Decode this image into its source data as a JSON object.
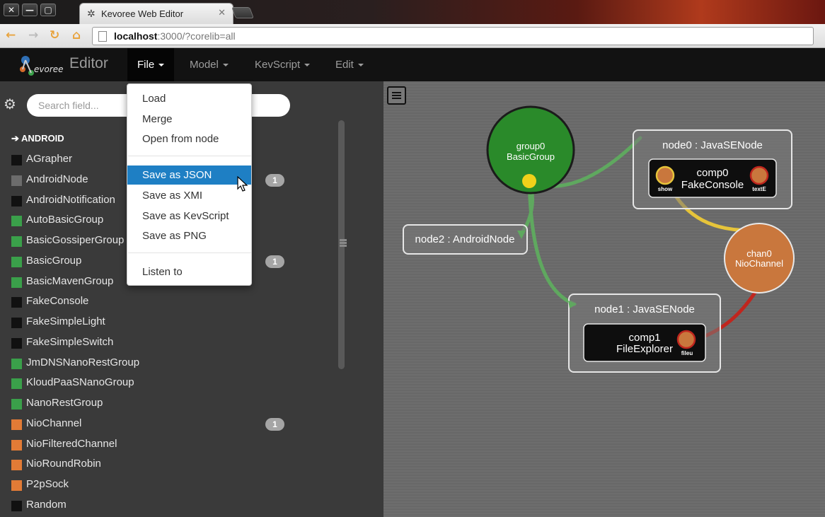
{
  "browser": {
    "window_buttons": [
      "✕",
      "—",
      "▢"
    ],
    "tab_title": "Kevoree Web Editor",
    "tab_close": "✕",
    "nav": {
      "back": "←",
      "forward": "→",
      "reload": "↻",
      "home": "⌂"
    },
    "url_host": "localhost",
    "url_rest": ":3000/?corelib=all"
  },
  "navbar": {
    "brand": "Editor",
    "menus": [
      {
        "label": "File",
        "active": true
      },
      {
        "label": "Model",
        "active": false
      },
      {
        "label": "KevScript",
        "active": false
      },
      {
        "label": "Edit",
        "active": false
      }
    ]
  },
  "file_menu": {
    "items": [
      "Load",
      "Merge",
      "Open from node",
      "Save as JSON",
      "Save as XMI",
      "Save as KevScript",
      "Save as PNG",
      "Listen to"
    ],
    "hovered": "Save as JSON"
  },
  "sidebar": {
    "search_placeholder": "Search field...",
    "section": "➔ ANDROID",
    "items": [
      {
        "label": "AGrapher",
        "color": "#111111"
      },
      {
        "label": "AndroidNode",
        "color": "#6c6c6c",
        "badge": "1"
      },
      {
        "label": "AndroidNotification",
        "color": "#111111"
      },
      {
        "label": "AutoBasicGroup",
        "color": "#3aa04a"
      },
      {
        "label": "BasicGossiperGroup",
        "color": "#3aa04a"
      },
      {
        "label": "BasicGroup",
        "color": "#3aa04a",
        "badge": "1"
      },
      {
        "label": "BasicMavenGroup",
        "color": "#3aa04a"
      },
      {
        "label": "FakeConsole",
        "color": "#111111"
      },
      {
        "label": "FakeSimpleLight",
        "color": "#111111"
      },
      {
        "label": "FakeSimpleSwitch",
        "color": "#111111"
      },
      {
        "label": "JmDNSNanoRestGroup",
        "color": "#3aa04a"
      },
      {
        "label": "KloudPaaSNanoGroup",
        "color": "#3aa04a"
      },
      {
        "label": "NanoRestGroup",
        "color": "#3aa04a"
      },
      {
        "label": "NioChannel",
        "color": "#e27b36",
        "badge": "1"
      },
      {
        "label": "NioFilteredChannel",
        "color": "#e27b36"
      },
      {
        "label": "NioRoundRobin",
        "color": "#e27b36"
      },
      {
        "label": "P2pSock",
        "color": "#e27b36"
      },
      {
        "label": "Random",
        "color": "#111111"
      }
    ]
  },
  "canvas": {
    "group": {
      "name": "group0",
      "type": "BasicGroup",
      "color": "#2a8a2a"
    },
    "nodes": [
      {
        "title": "node0 : JavaSENode"
      },
      {
        "title": "node1 : JavaSENode"
      },
      {
        "title": "node2 : AndroidNode"
      }
    ],
    "components": [
      {
        "name": "comp0",
        "type": "FakeConsole",
        "ports": [
          "show",
          "textE"
        ]
      },
      {
        "name": "comp1",
        "type": "FileExplorer",
        "ports": [
          "fileu"
        ]
      }
    ],
    "channel": {
      "name": "chan0",
      "type": "NioChannel",
      "color": "#c9773d"
    },
    "link_colors": {
      "group": "#5fa85f",
      "binding_yellow": "#e6c43a",
      "binding_red": "#c0261e"
    }
  }
}
